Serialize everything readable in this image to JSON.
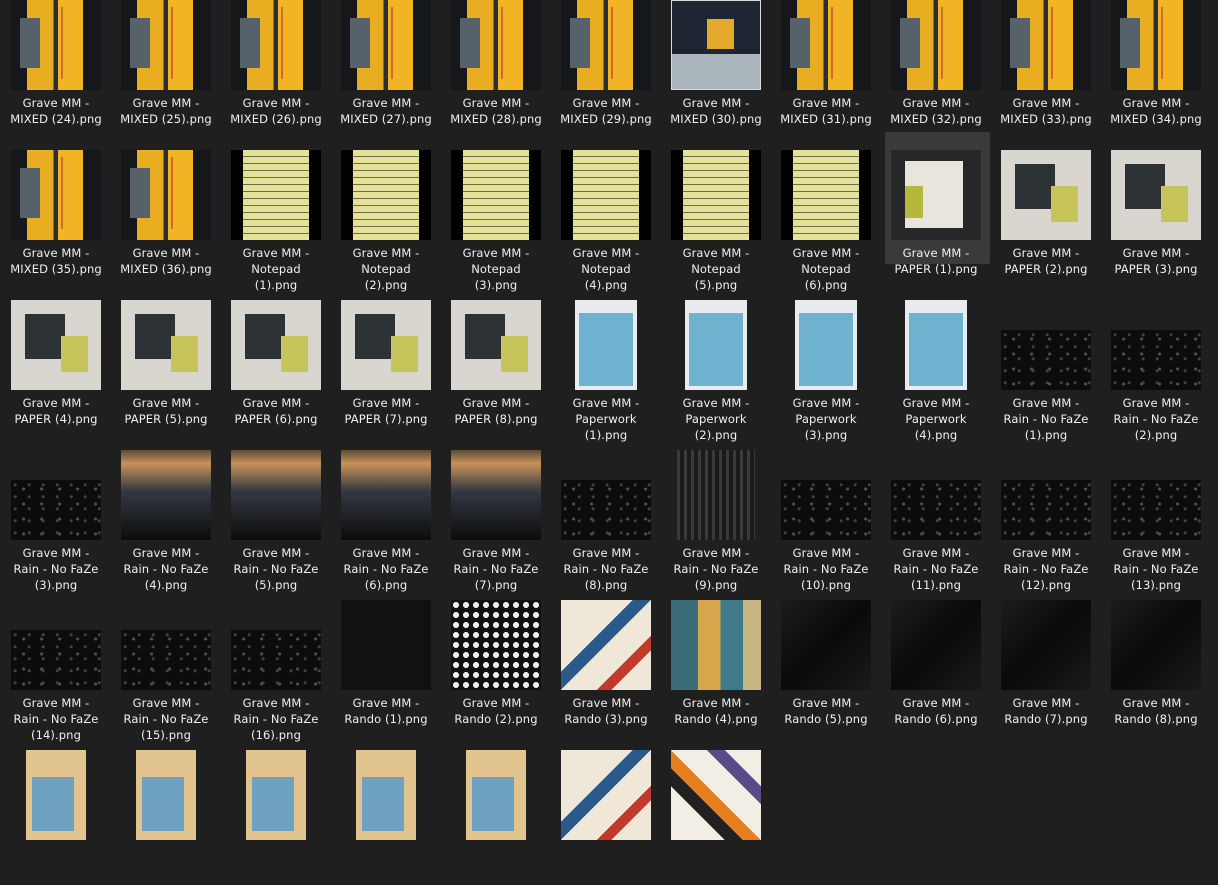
{
  "view": "file-explorer-grid",
  "selected_index": 19,
  "items": [
    {
      "kind": "mixed",
      "lines": [
        "Grave MM -",
        "MIXED (24).png"
      ]
    },
    {
      "kind": "mixed",
      "lines": [
        "Grave MM -",
        "MIXED (25).png"
      ]
    },
    {
      "kind": "mixed",
      "lines": [
        "Grave MM -",
        "MIXED (26).png"
      ]
    },
    {
      "kind": "mixed",
      "lines": [
        "Grave MM -",
        "MIXED (27).png"
      ]
    },
    {
      "kind": "mixed",
      "lines": [
        "Grave MM -",
        "MIXED (28).png"
      ]
    },
    {
      "kind": "mixed",
      "lines": [
        "Grave MM -",
        "MIXED (29).png"
      ]
    },
    {
      "kind": "mixed-light",
      "lines": [
        "Grave MM -",
        "MIXED (30).png"
      ]
    },
    {
      "kind": "mixed",
      "lines": [
        "Grave MM -",
        "MIXED (31).png"
      ]
    },
    {
      "kind": "mixed",
      "lines": [
        "Grave MM -",
        "MIXED (32).png"
      ]
    },
    {
      "kind": "mixed",
      "lines": [
        "Grave MM -",
        "MIXED (33).png"
      ]
    },
    {
      "kind": "mixed",
      "lines": [
        "Grave MM -",
        "MIXED (34).png"
      ]
    },
    {
      "kind": "mixed",
      "lines": [
        "Grave MM -",
        "MIXED (35).png"
      ]
    },
    {
      "kind": "mixed",
      "lines": [
        "Grave MM -",
        "MIXED (36).png"
      ]
    },
    {
      "kind": "notepad",
      "lines": [
        "Grave MM -",
        "Notepad",
        "(1).png"
      ]
    },
    {
      "kind": "notepad",
      "lines": [
        "Grave MM -",
        "Notepad",
        "(2).png"
      ]
    },
    {
      "kind": "notepad",
      "lines": [
        "Grave MM -",
        "Notepad",
        "(3).png"
      ]
    },
    {
      "kind": "notepad",
      "lines": [
        "Grave MM -",
        "Notepad",
        "(4).png"
      ]
    },
    {
      "kind": "notepad",
      "lines": [
        "Grave MM -",
        "Notepad",
        "(5).png"
      ]
    },
    {
      "kind": "notepad",
      "lines": [
        "Grave MM -",
        "Notepad",
        "(6).png"
      ]
    },
    {
      "kind": "paper-dark",
      "lines": [
        "Grave MM -",
        "PAPER (1).png"
      ]
    },
    {
      "kind": "paper",
      "lines": [
        "Grave MM -",
        "PAPER (2).png"
      ]
    },
    {
      "kind": "paper",
      "lines": [
        "Grave MM -",
        "PAPER (3).png"
      ]
    },
    {
      "kind": "paper",
      "lines": [
        "Grave MM -",
        "PAPER (4).png"
      ]
    },
    {
      "kind": "paper",
      "lines": [
        "Grave MM -",
        "PAPER (5).png"
      ]
    },
    {
      "kind": "paper",
      "lines": [
        "Grave MM -",
        "PAPER (6).png"
      ]
    },
    {
      "kind": "paper",
      "lines": [
        "Grave MM -",
        "PAPER (7).png"
      ]
    },
    {
      "kind": "paper",
      "lines": [
        "Grave MM -",
        "PAPER (8).png"
      ]
    },
    {
      "kind": "paperwork",
      "lines": [
        "Grave MM -",
        "Paperwork",
        "(1).png"
      ]
    },
    {
      "kind": "paperwork",
      "lines": [
        "Grave MM -",
        "Paperwork",
        "(2).png"
      ]
    },
    {
      "kind": "paperwork",
      "lines": [
        "Grave MM -",
        "Paperwork",
        "(3).png"
      ]
    },
    {
      "kind": "paperwork",
      "lines": [
        "Grave MM -",
        "Paperwork",
        "(4).png"
      ]
    },
    {
      "kind": "rain",
      "lines": [
        "Grave MM -",
        "Rain - No FaZe",
        "(1).png"
      ]
    },
    {
      "kind": "rain",
      "lines": [
        "Grave MM -",
        "Rain - No FaZe",
        "(2).png"
      ]
    },
    {
      "kind": "rain",
      "lines": [
        "Grave MM -",
        "Rain - No FaZe",
        "(3).png"
      ]
    },
    {
      "kind": "window",
      "lines": [
        "Grave MM -",
        "Rain - No FaZe",
        "(4).png"
      ]
    },
    {
      "kind": "window",
      "lines": [
        "Grave MM -",
        "Rain - No FaZe",
        "(5).png"
      ]
    },
    {
      "kind": "window",
      "lines": [
        "Grave MM -",
        "Rain - No FaZe",
        "(6).png"
      ]
    },
    {
      "kind": "window",
      "lines": [
        "Grave MM -",
        "Rain - No FaZe",
        "(7).png"
      ]
    },
    {
      "kind": "rain",
      "lines": [
        "Grave MM -",
        "Rain - No FaZe",
        "(8).png"
      ]
    },
    {
      "kind": "window-tall",
      "lines": [
        "Grave MM -",
        "Rain - No FaZe",
        "(9).png"
      ]
    },
    {
      "kind": "rain",
      "lines": [
        "Grave MM -",
        "Rain - No FaZe",
        "(10).png"
      ]
    },
    {
      "kind": "rain",
      "lines": [
        "Grave MM -",
        "Rain - No FaZe",
        "(11).png"
      ]
    },
    {
      "kind": "rain",
      "lines": [
        "Grave MM -",
        "Rain - No FaZe",
        "(12).png"
      ]
    },
    {
      "kind": "rain",
      "lines": [
        "Grave MM -",
        "Rain - No FaZe",
        "(13).png"
      ]
    },
    {
      "kind": "rain",
      "lines": [
        "Grave MM -",
        "Rain - No FaZe",
        "(14).png"
      ]
    },
    {
      "kind": "rain",
      "lines": [
        "Grave MM -",
        "Rain - No FaZe",
        "(15).png"
      ]
    },
    {
      "kind": "rain",
      "lines": [
        "Grave MM -",
        "Rain - No FaZe",
        "(16).png"
      ]
    },
    {
      "kind": "dark-sq",
      "lines": [
        "Grave MM -",
        "Rando (1).png"
      ]
    },
    {
      "kind": "cells",
      "lines": [
        "Grave MM -",
        "Rando (2).png"
      ]
    },
    {
      "kind": "abstract",
      "lines": [
        "Grave MM -",
        "Rando (3).png"
      ]
    },
    {
      "kind": "grunge",
      "lines": [
        "Grave MM -",
        "Rando (4).png"
      ]
    },
    {
      "kind": "crumpled",
      "lines": [
        "Grave MM -",
        "Rando (5).png"
      ]
    },
    {
      "kind": "crumpled",
      "lines": [
        "Grave MM -",
        "Rando (6).png"
      ]
    },
    {
      "kind": "crumpled",
      "lines": [
        "Grave MM -",
        "Rando (7).png"
      ]
    },
    {
      "kind": "crumpled",
      "lines": [
        "Grave MM -",
        "Rando (8).png"
      ]
    },
    {
      "kind": "beige",
      "lines": []
    },
    {
      "kind": "beige",
      "lines": []
    },
    {
      "kind": "beige",
      "lines": []
    },
    {
      "kind": "beige",
      "lines": []
    },
    {
      "kind": "beige",
      "lines": []
    },
    {
      "kind": "abstract",
      "lines": []
    },
    {
      "kind": "chaos",
      "lines": []
    }
  ]
}
